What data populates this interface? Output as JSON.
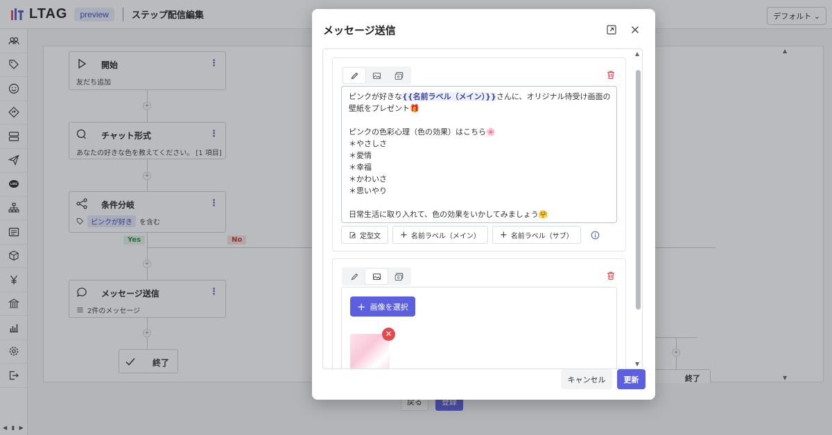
{
  "app": {
    "logo_text": "LTAG",
    "badge": "preview",
    "page_title": "ステップ配信編集",
    "default_select": "デフォルト ⌄"
  },
  "sidebar": {
    "icons": [
      "users-icon",
      "tag-icon",
      "smile-icon",
      "diamond-arrow-icon",
      "server-icon",
      "send-icon",
      "line-icon",
      "sitemap-icon",
      "form-icon",
      "box-icon",
      "yen-icon",
      "bank-icon",
      "chart-icon",
      "gear-icon",
      "logout-icon"
    ],
    "footer": "◀ ▮ ▶"
  },
  "flow": {
    "start": {
      "title": "開始",
      "sub": "友だち追加"
    },
    "chat": {
      "title": "チャット形式",
      "sub": "あなたの好きな色を教えてください。 [1 項目]"
    },
    "branch": {
      "title": "条件分岐",
      "tag": "ピンクが好き",
      "sub_suffix": "を含む"
    },
    "yes": "Yes",
    "no": "No",
    "message": {
      "title": "メッセージ送信",
      "sub": "2件のメッセージ"
    },
    "end": {
      "title": "終了"
    },
    "end_right": {
      "title": "終了"
    },
    "kebab": "⋮",
    "plus": "+"
  },
  "bottom": {
    "back": "戻る",
    "register": "登録"
  },
  "modal": {
    "title": "メッセージ送信",
    "text_card": {
      "lines_before_var": "ピンクが好きな",
      "var": "{{名前ラベル（メイン）}}",
      "lines_after_var": "さんに、オリジナル待受け画面の",
      "line2": "壁紙をプレゼント🎁",
      "line3": "",
      "line4": "ピンクの色彩心理（色の効果）はこちら🌸",
      "line5": "＊やさしさ",
      "line6": "＊愛情",
      "line7": "＊幸福",
      "line8": "＊かわいさ",
      "line9": "＊思いやり",
      "line10": "",
      "line11": "日常生活に取り入れて、色の効果をいかしてみましょう🤗"
    },
    "buttons": {
      "template": "定型文",
      "main_label": "名前ラベル（メイン）",
      "sub_label": "名前ラベル（サブ）"
    },
    "image_card": {
      "pick": "画像を選択",
      "remove": "✕"
    },
    "cancel": "キャンセル",
    "update": "更新"
  },
  "colors": {
    "accent": "#5b5fe0",
    "danger": "#e5484d",
    "yes_bg": "#dff3e4",
    "no_bg": "#fbe0e0"
  }
}
